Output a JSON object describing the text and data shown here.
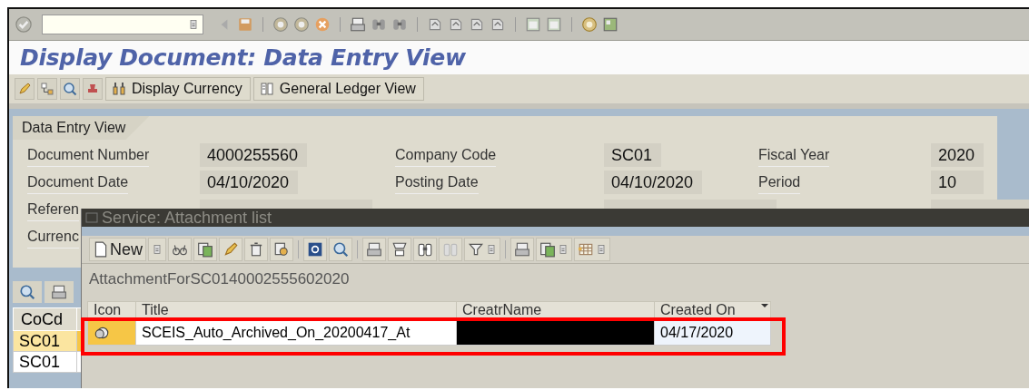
{
  "title": "Display Document: Data Entry View",
  "app_toolbar": {
    "buttons": [
      {
        "label": "Display Currency"
      },
      {
        "label": "General Ledger View"
      }
    ]
  },
  "header": {
    "tab": "Data Entry View",
    "rows": [
      [
        {
          "label": "Document Number",
          "value": "4000255560"
        },
        {
          "label": "Company Code",
          "value": "SC01"
        },
        {
          "label": "Fiscal Year",
          "value": "2020"
        }
      ],
      [
        {
          "label": "Document Date",
          "value": "04/10/2020"
        },
        {
          "label": "Posting Date",
          "value": "04/10/2020"
        },
        {
          "label": "Period",
          "value": "10"
        }
      ],
      [
        {
          "label": "Referen",
          "field": true
        },
        {
          "field": true
        },
        {
          "field": true
        }
      ],
      [
        {
          "label": "Currenc"
        }
      ]
    ]
  },
  "line_items": {
    "columns": [
      "CoCd"
    ],
    "rows": [
      {
        "cells": [
          "SC01"
        ],
        "selected": true
      },
      {
        "cells": [
          "SC01"
        ],
        "selected": false
      }
    ]
  },
  "popup": {
    "title": "Service: Attachment list",
    "new_button": "New",
    "object": "AttachmentForSC0140002555602020",
    "columns": [
      "Icon",
      "Title",
      "CreatrName",
      "Created On"
    ],
    "rows": [
      {
        "title": "SCEIS_Auto_Archived_On_20200417_At",
        "creator_redacted": true,
        "created_on": "04/17/2020",
        "selected": true,
        "highlighted": true
      }
    ]
  }
}
